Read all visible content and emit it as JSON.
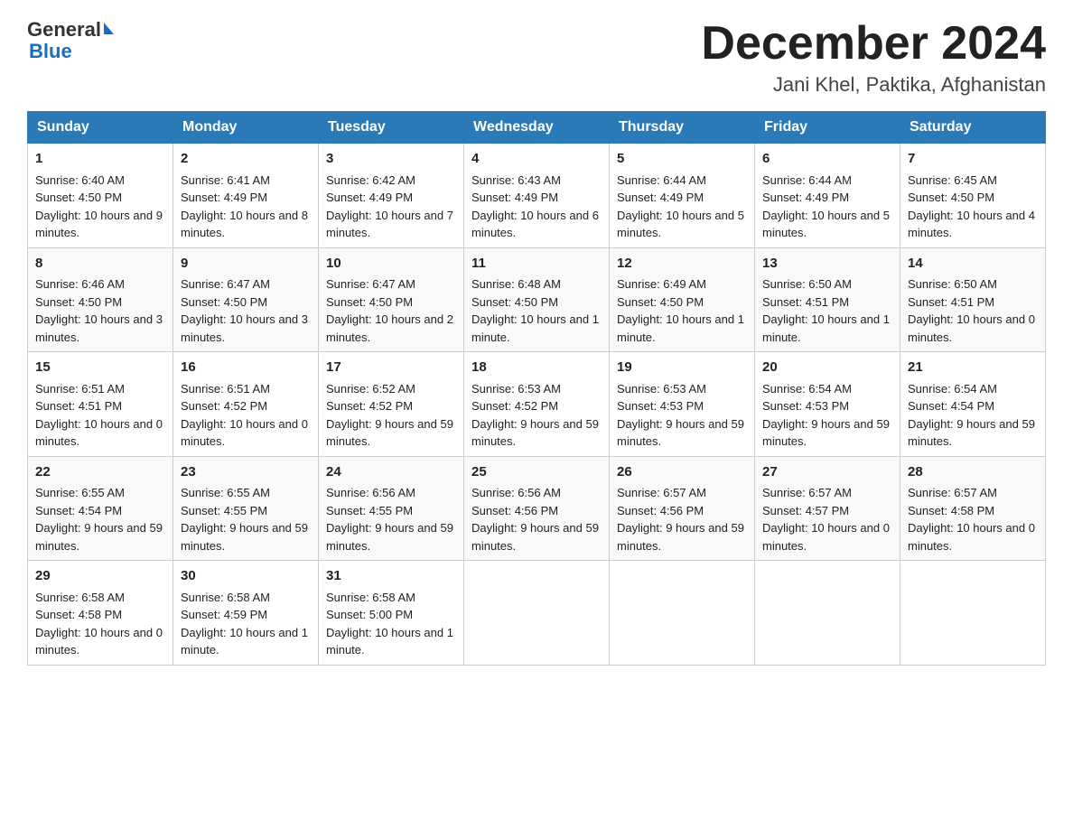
{
  "header": {
    "logo": {
      "general": "General",
      "arrow": "▶",
      "blue": "Blue"
    },
    "title": "December 2024",
    "subtitle": "Jani Khel, Paktika, Afghanistan"
  },
  "days": [
    "Sunday",
    "Monday",
    "Tuesday",
    "Wednesday",
    "Thursday",
    "Friday",
    "Saturday"
  ],
  "weeks": [
    [
      {
        "date": "1",
        "sunrise": "6:40 AM",
        "sunset": "4:50 PM",
        "daylight": "10 hours and 9 minutes."
      },
      {
        "date": "2",
        "sunrise": "6:41 AM",
        "sunset": "4:49 PM",
        "daylight": "10 hours and 8 minutes."
      },
      {
        "date": "3",
        "sunrise": "6:42 AM",
        "sunset": "4:49 PM",
        "daylight": "10 hours and 7 minutes."
      },
      {
        "date": "4",
        "sunrise": "6:43 AM",
        "sunset": "4:49 PM",
        "daylight": "10 hours and 6 minutes."
      },
      {
        "date": "5",
        "sunrise": "6:44 AM",
        "sunset": "4:49 PM",
        "daylight": "10 hours and 5 minutes."
      },
      {
        "date": "6",
        "sunrise": "6:44 AM",
        "sunset": "4:49 PM",
        "daylight": "10 hours and 5 minutes."
      },
      {
        "date": "7",
        "sunrise": "6:45 AM",
        "sunset": "4:50 PM",
        "daylight": "10 hours and 4 minutes."
      }
    ],
    [
      {
        "date": "8",
        "sunrise": "6:46 AM",
        "sunset": "4:50 PM",
        "daylight": "10 hours and 3 minutes."
      },
      {
        "date": "9",
        "sunrise": "6:47 AM",
        "sunset": "4:50 PM",
        "daylight": "10 hours and 3 minutes."
      },
      {
        "date": "10",
        "sunrise": "6:47 AM",
        "sunset": "4:50 PM",
        "daylight": "10 hours and 2 minutes."
      },
      {
        "date": "11",
        "sunrise": "6:48 AM",
        "sunset": "4:50 PM",
        "daylight": "10 hours and 1 minute."
      },
      {
        "date": "12",
        "sunrise": "6:49 AM",
        "sunset": "4:50 PM",
        "daylight": "10 hours and 1 minute."
      },
      {
        "date": "13",
        "sunrise": "6:50 AM",
        "sunset": "4:51 PM",
        "daylight": "10 hours and 1 minute."
      },
      {
        "date": "14",
        "sunrise": "6:50 AM",
        "sunset": "4:51 PM",
        "daylight": "10 hours and 0 minutes."
      }
    ],
    [
      {
        "date": "15",
        "sunrise": "6:51 AM",
        "sunset": "4:51 PM",
        "daylight": "10 hours and 0 minutes."
      },
      {
        "date": "16",
        "sunrise": "6:51 AM",
        "sunset": "4:52 PM",
        "daylight": "10 hours and 0 minutes."
      },
      {
        "date": "17",
        "sunrise": "6:52 AM",
        "sunset": "4:52 PM",
        "daylight": "9 hours and 59 minutes."
      },
      {
        "date": "18",
        "sunrise": "6:53 AM",
        "sunset": "4:52 PM",
        "daylight": "9 hours and 59 minutes."
      },
      {
        "date": "19",
        "sunrise": "6:53 AM",
        "sunset": "4:53 PM",
        "daylight": "9 hours and 59 minutes."
      },
      {
        "date": "20",
        "sunrise": "6:54 AM",
        "sunset": "4:53 PM",
        "daylight": "9 hours and 59 minutes."
      },
      {
        "date": "21",
        "sunrise": "6:54 AM",
        "sunset": "4:54 PM",
        "daylight": "9 hours and 59 minutes."
      }
    ],
    [
      {
        "date": "22",
        "sunrise": "6:55 AM",
        "sunset": "4:54 PM",
        "daylight": "9 hours and 59 minutes."
      },
      {
        "date": "23",
        "sunrise": "6:55 AM",
        "sunset": "4:55 PM",
        "daylight": "9 hours and 59 minutes."
      },
      {
        "date": "24",
        "sunrise": "6:56 AM",
        "sunset": "4:55 PM",
        "daylight": "9 hours and 59 minutes."
      },
      {
        "date": "25",
        "sunrise": "6:56 AM",
        "sunset": "4:56 PM",
        "daylight": "9 hours and 59 minutes."
      },
      {
        "date": "26",
        "sunrise": "6:57 AM",
        "sunset": "4:56 PM",
        "daylight": "9 hours and 59 minutes."
      },
      {
        "date": "27",
        "sunrise": "6:57 AM",
        "sunset": "4:57 PM",
        "daylight": "10 hours and 0 minutes."
      },
      {
        "date": "28",
        "sunrise": "6:57 AM",
        "sunset": "4:58 PM",
        "daylight": "10 hours and 0 minutes."
      }
    ],
    [
      {
        "date": "29",
        "sunrise": "6:58 AM",
        "sunset": "4:58 PM",
        "daylight": "10 hours and 0 minutes."
      },
      {
        "date": "30",
        "sunrise": "6:58 AM",
        "sunset": "4:59 PM",
        "daylight": "10 hours and 1 minute."
      },
      {
        "date": "31",
        "sunrise": "6:58 AM",
        "sunset": "5:00 PM",
        "daylight": "10 hours and 1 minute."
      },
      null,
      null,
      null,
      null
    ]
  ]
}
